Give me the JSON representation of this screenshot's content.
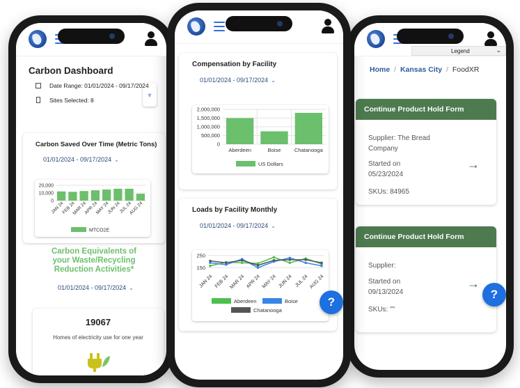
{
  "colors": {
    "accent": "#2f6fdc",
    "green": "#6cbf6c",
    "dark_green": "#4d7a4f",
    "help": "#1e6fe0"
  },
  "left_phone": {
    "title": "Carbon Dashboard",
    "date_range_label": "Date Range: 01/01/2024 - 09/17/2024",
    "sites_selected_label": "Sites Selected: 8",
    "carbon_card": {
      "title": "Carbon Saved Over Time (Metric Tons)",
      "range": "01/01/2024 - 09/17/2024",
      "legend": "MTCO2E"
    },
    "equivalents_title": "Carbon Equivalents of your Waste/Recycling Reduction Activities*",
    "equivalents_range": "01/01/2024 - 09/17/2024",
    "stat_value": "19067",
    "stat_label": "Homes of electricity use for one year"
  },
  "middle_phone": {
    "compensation_card": {
      "title": "Compensation by Facility",
      "range": "01/01/2024 - 09/17/2024",
      "legend": "US Dollars"
    },
    "loads_card": {
      "title": "Loads by Facility Monthly",
      "range": "01/01/2024 - 09/17/2024",
      "legend": [
        "Aberdeen",
        "Boise",
        "Chatanooga"
      ]
    },
    "help_label": "?"
  },
  "right_phone": {
    "legend_label": "Legend",
    "breadcrumb": [
      "Home",
      "Kansas City",
      "FoodXR"
    ],
    "cards": [
      {
        "title": "Continue Product Hold Form",
        "supplier": "Supplier: The Bread Company",
        "started_label": "Started on",
        "started_date": "05/23/2024",
        "skus": "SKUs: 84965"
      },
      {
        "title": "Continue Product Hold Form",
        "supplier": "Supplier:",
        "started_label": "Started on",
        "started_date": "09/13/2024",
        "skus": "SKUs: \"\""
      }
    ],
    "help_label": "?"
  },
  "chart_data": [
    {
      "type": "bar",
      "categories": [
        "JAN 24",
        "FEB 24",
        "MAR 24",
        "APR 24",
        "MAY 24",
        "JUN 24",
        "JUL 24",
        "AUG 24"
      ],
      "values": [
        12000,
        11500,
        12500,
        13500,
        14500,
        15500,
        15500,
        9000
      ],
      "series": [
        {
          "name": "MTCO2E",
          "values": [
            12000,
            11500,
            12500,
            13500,
            14500,
            15500,
            15500,
            9000
          ]
        }
      ],
      "yticks": [
        "20,000",
        "10,000",
        "0"
      ],
      "ylim": [
        0,
        20000
      ],
      "grid": true,
      "legend": "bottom"
    },
    {
      "type": "bar",
      "title": "Compensation by Facility",
      "categories": [
        "Aberdeen",
        "Boise",
        "Chatanooga"
      ],
      "series": [
        {
          "name": "US Dollars",
          "values": [
            1500000,
            740000,
            1800000
          ]
        }
      ],
      "yticks": [
        "2,000,000",
        "1,500,000",
        "1,000,000",
        "500,000",
        "0"
      ],
      "ylim": [
        0,
        2000000
      ],
      "grid": true,
      "legend": "bottom"
    },
    {
      "type": "line",
      "title": "Loads by Facility Monthly",
      "categories": [
        "JAN 24",
        "FEB 24",
        "MAR 24",
        "APR 24",
        "MAY 24",
        "JUN 24",
        "JUL 24",
        "AUG 24"
      ],
      "series": [
        {
          "name": "Aberdeen",
          "values": [
            165,
            195,
            190,
            185,
            235,
            190,
            225,
            180
          ]
        },
        {
          "name": "Boise",
          "values": [
            190,
            175,
            220,
            150,
            200,
            230,
            190,
            165
          ]
        },
        {
          "name": "Chatanooga",
          "values": [
            205,
            190,
            210,
            170,
            210,
            215,
            215,
            190
          ]
        }
      ],
      "yticks": [
        "250",
        "150"
      ],
      "ylim": [
        100,
        260
      ],
      "grid": true,
      "legend": "bottom"
    }
  ]
}
